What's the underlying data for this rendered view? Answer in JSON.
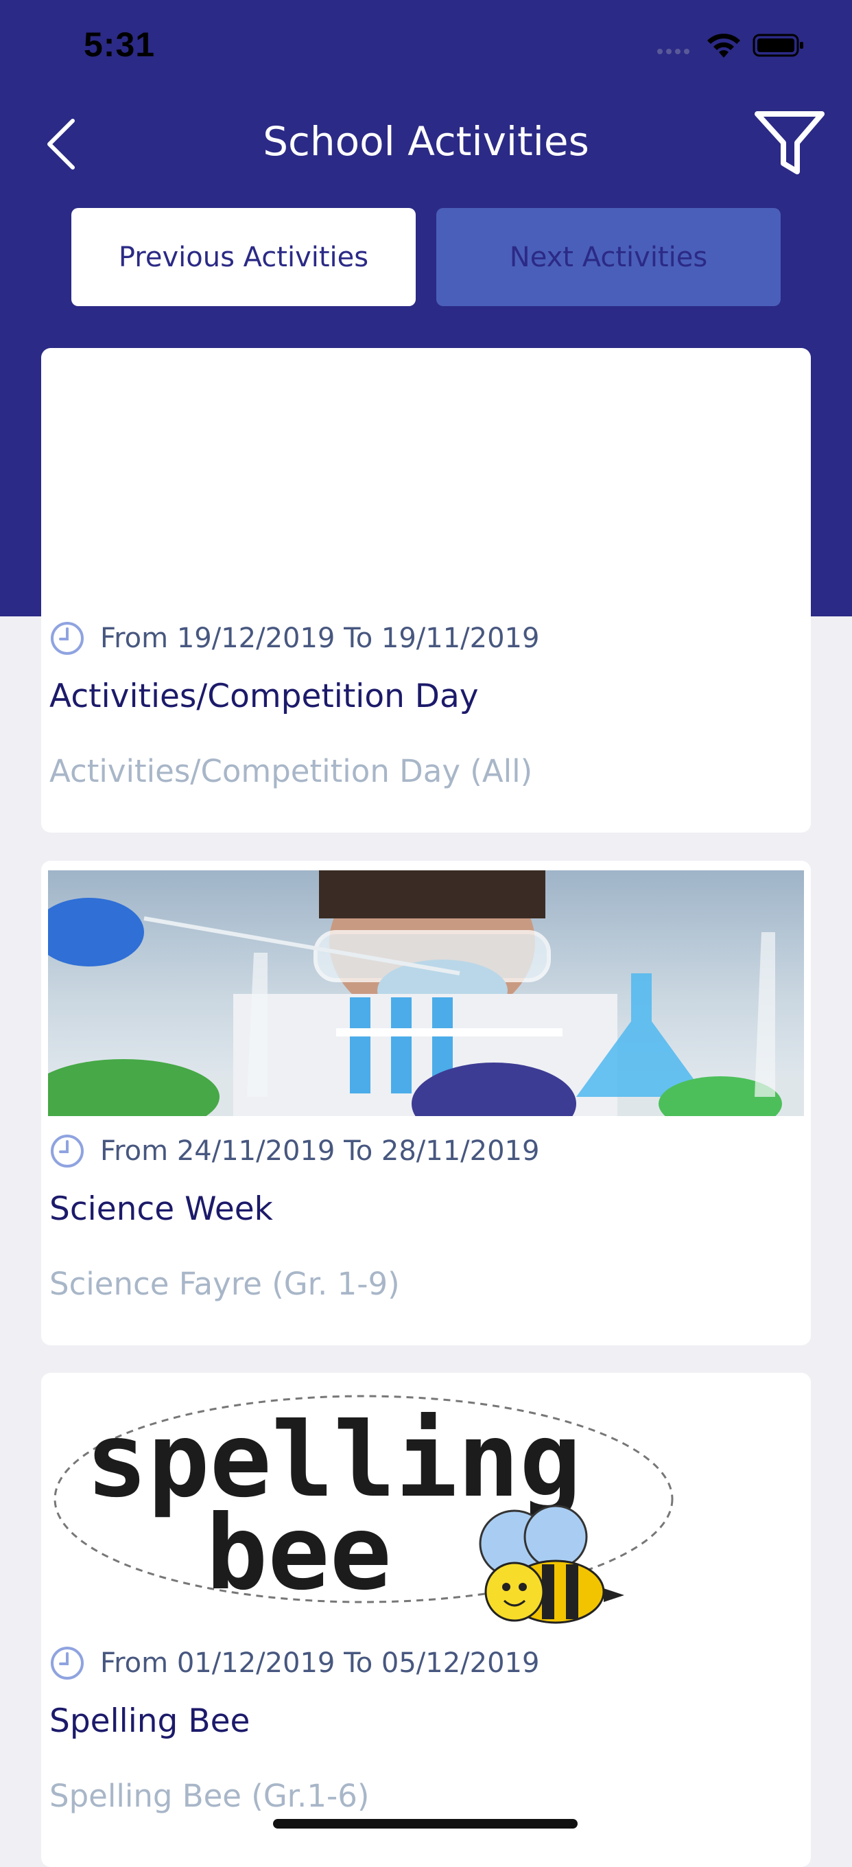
{
  "status_bar": {
    "time": "5:31"
  },
  "nav": {
    "title": "School Activities",
    "back_icon": "chevron-left-icon",
    "filter_icon": "filter-funnel-icon"
  },
  "tabs": {
    "previous": "Previous Activities",
    "next": "Next Activities"
  },
  "colors": {
    "header": "#2b2a86",
    "tab_active_bg": "#ffffff",
    "tab_inactive_bg": "#4a5fb9",
    "title_text": "#1c1a6a",
    "subtitle_text": "#a8b6c8",
    "date_text": "#47577f"
  },
  "activities": [
    {
      "image": "none",
      "date": "From 19/12/2019 To 19/11/2019",
      "title": "Activities/Competition Day",
      "subtitle": "Activities/Competition Day (All)"
    },
    {
      "image": "scientist-lab-photo",
      "date": "From 24/11/2019 To 28/11/2019",
      "title": "Science Week",
      "subtitle": "Science Fayre (Gr. 1-9)"
    },
    {
      "image": "spelling-bee-logo",
      "image_text": "spelling bee",
      "date": "From 01/12/2019 To 05/12/2019",
      "title": "Spelling Bee",
      "subtitle": "Spelling Bee (Gr.1-6)"
    }
  ]
}
